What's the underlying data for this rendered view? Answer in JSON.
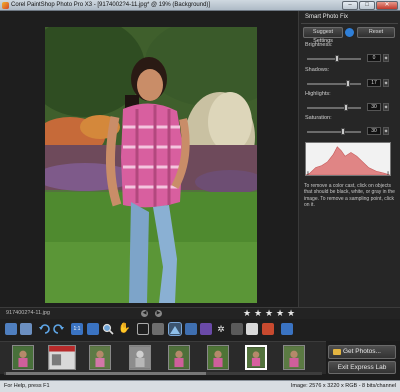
{
  "window": {
    "title": "Corel PaintShop Photo Pro X3 - [9174002?4-11.jpg* @ 19% (Background)]",
    "controls": [
      "–",
      "□",
      "✕"
    ]
  },
  "panel": {
    "title": "Smart Photo Fix",
    "suggest_label": "Suggest Settings",
    "reset_label": "Reset",
    "sliders": [
      {
        "label": "Brightness:",
        "value": "0",
        "level": 0.55
      },
      {
        "label": "Shadows:",
        "value": "17",
        "level": 0.78
      },
      {
        "label": "Highlights:",
        "value": "30",
        "level": 0.74
      },
      {
        "label": "Saturation:",
        "value": "30",
        "level": 0.68
      }
    ],
    "help_text": "To remove a color cast, click on objects that should be black, white, or gray in the image. To remove a sampling point, click on it."
  },
  "file_strip": {
    "file_name": "9174002?4-11.jpg",
    "rating_stars": [
      "★",
      "★",
      "★",
      "★",
      "★"
    ]
  },
  "filmstrip": {
    "get_photos_label": "Get Photos...",
    "exit_label": "Exit Express Lab"
  },
  "statusbar": {
    "left": "For Help, press F1",
    "right": "Image: 2576 x 3220 x RGB - 8 bits/channel"
  },
  "icons": {
    "toolbar": [
      "save-icon",
      "save-as-icon",
      "undo-icon",
      "redo-icon",
      "actual-size-icon",
      "fit-icon",
      "zoom-icon",
      "pan-icon",
      "crop-icon",
      "straighten-icon",
      "red-eye-icon",
      "rotate-left-icon",
      "rotate-right-icon",
      "retouch-icon",
      "smart-fix-icon",
      "makeover-icon",
      "info-icon"
    ]
  },
  "colors": {
    "accent": "#2f7fd8",
    "histogram_fill": "#e08585"
  }
}
